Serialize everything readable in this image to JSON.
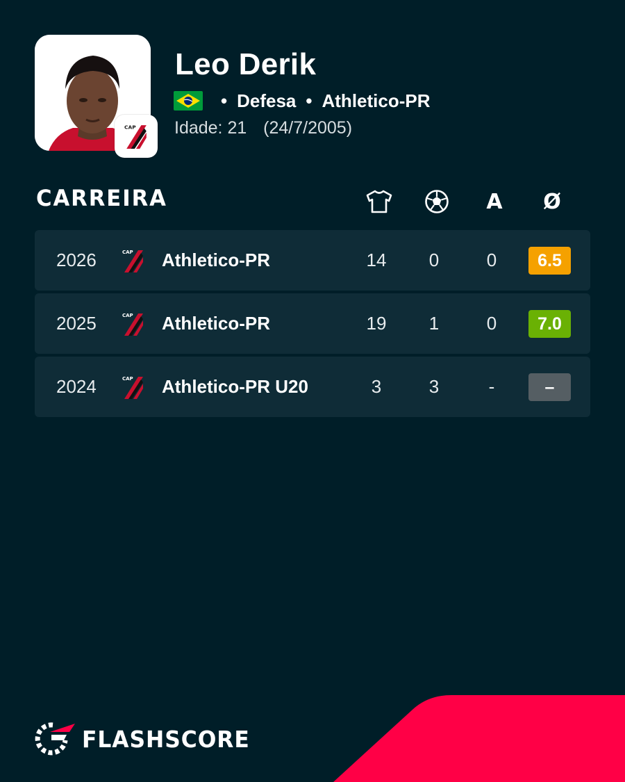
{
  "player": {
    "name": "Leo Derik",
    "country_flag": "brazil-flag",
    "position": "Defesa",
    "club": "Athletico-PR",
    "age_label": "Idade: 21",
    "birth_date": "(24/7/2005)"
  },
  "career": {
    "title": "CARREIRA",
    "columns": [
      {
        "icon": "jersey-icon",
        "meaning": "appearances"
      },
      {
        "icon": "football-icon",
        "meaning": "goals"
      },
      {
        "label": "A",
        "meaning": "assists"
      },
      {
        "label": "Ø",
        "meaning": "average rating"
      }
    ],
    "rows": [
      {
        "year": "2026",
        "team": "Athletico-PR",
        "apps": "14",
        "goals": "0",
        "assists": "0",
        "rating": "6.5",
        "rating_color": "#f5a100"
      },
      {
        "year": "2025",
        "team": "Athletico-PR",
        "apps": "19",
        "goals": "1",
        "assists": "0",
        "rating": "7.0",
        "rating_color": "#6ab104"
      },
      {
        "year": "2024",
        "team": "Athletico-PR U20",
        "apps": "3",
        "goals": "3",
        "assists": "-",
        "rating": "–",
        "rating_color": "#555e63"
      }
    ]
  },
  "brand": {
    "name": "FLASHSCORE",
    "accent_color": "#ff0046",
    "background_color": "#001e28"
  }
}
